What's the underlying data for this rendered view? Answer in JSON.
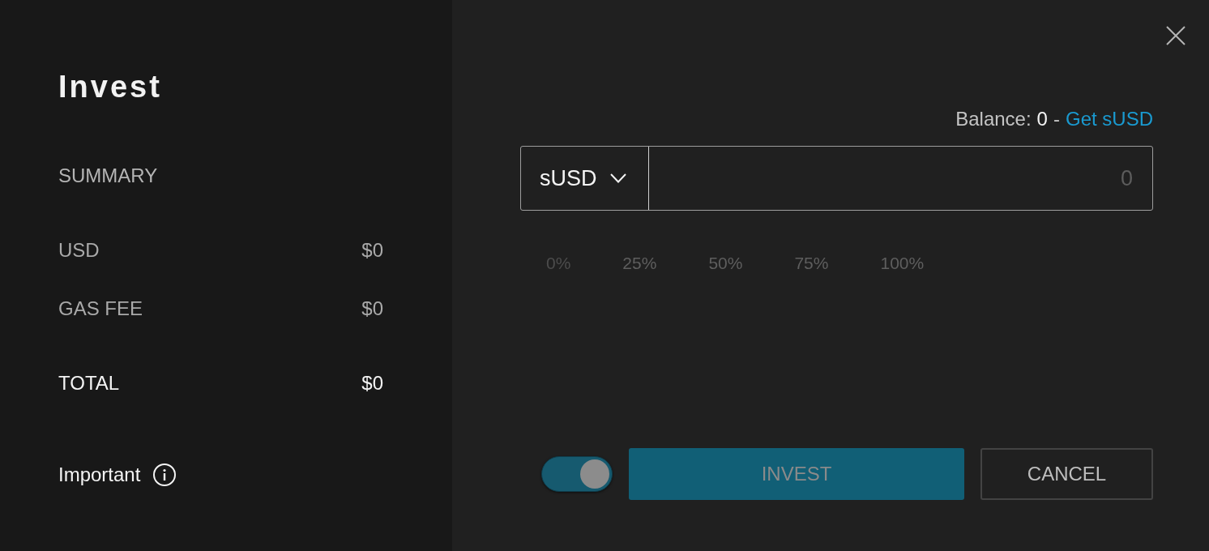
{
  "dialog": {
    "title": "Invest"
  },
  "summary": {
    "heading": "SUMMARY",
    "rows": [
      {
        "label": "USD",
        "value": "$0",
        "kind": "item"
      },
      {
        "label": "GAS FEE",
        "value": "$0",
        "kind": "item"
      },
      {
        "label": "TOTAL",
        "value": "$0",
        "kind": "total"
      }
    ],
    "note": "Important"
  },
  "balance": {
    "label": "Balance:",
    "value": "0",
    "separator": "-",
    "link": "Get sUSD"
  },
  "amount_field": {
    "token": "sUSD",
    "placeholder": "0"
  },
  "percent_buttons": [
    {
      "label": "0%",
      "disabled": true
    },
    {
      "label": "25%",
      "disabled": false
    },
    {
      "label": "50%",
      "disabled": false
    },
    {
      "label": "75%",
      "disabled": false
    },
    {
      "label": "100%",
      "disabled": false
    }
  ],
  "toggle": {
    "on": true
  },
  "buttons": [
    {
      "label": "INVEST",
      "kind": "primary",
      "disabled": true
    },
    {
      "label": "CANCEL",
      "kind": "secondary",
      "disabled": false
    }
  ]
}
